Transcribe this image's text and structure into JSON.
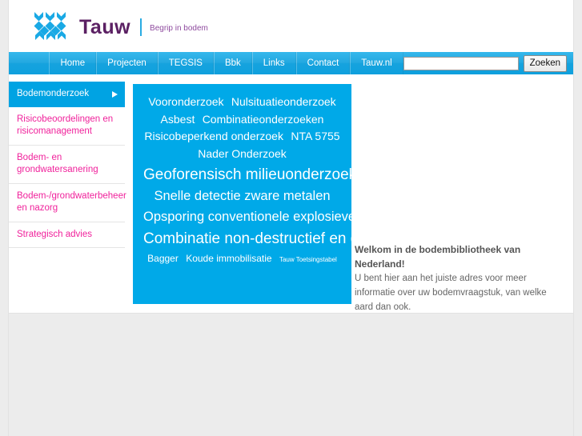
{
  "header": {
    "logo_icon": "tauw-lattice-logo",
    "brand": "Tauw",
    "tagline": "Begrip in bodem"
  },
  "nav": {
    "items": [
      {
        "label": "Home"
      },
      {
        "label": "Projecten"
      },
      {
        "label": "TEGSIS"
      },
      {
        "label": "Bbk"
      },
      {
        "label": "Links"
      },
      {
        "label": "Contact"
      },
      {
        "label": "Tauw.nl"
      }
    ],
    "search": {
      "value": "",
      "placeholder": "",
      "button_label": "Zoeken"
    }
  },
  "sidebar": {
    "items": [
      {
        "label": "Bodemonderzoek",
        "active": true
      },
      {
        "label": "Risicobeoordelingen en risicomanagement",
        "active": false
      },
      {
        "label": "Bodem- en grondwatersanering",
        "active": false
      },
      {
        "label": "Bodem-/grondwaterbeheer en nazorg",
        "active": false
      },
      {
        "label": "Strategisch advies",
        "active": false
      }
    ]
  },
  "tagcloud": {
    "tags": [
      {
        "label": "Vooronderzoek",
        "size": "md"
      },
      {
        "label": "Nulsituatieonderzoek",
        "size": "md"
      },
      {
        "label": "Asbest",
        "size": "md"
      },
      {
        "label": "Combinatieonderzoeken",
        "size": "md"
      },
      {
        "label": "Risicobeperkend onderzoek",
        "size": "md"
      },
      {
        "label": "NTA 5755",
        "size": "md"
      },
      {
        "label": "Nader Onderzoek",
        "size": "md"
      },
      {
        "label": "Geoforensisch milieuonderzoek",
        "size": "xl"
      },
      {
        "label": "Snelle detectie zware metalen",
        "size": "lg"
      },
      {
        "label": "Opsporing conventionele explosieven",
        "size": "lg"
      },
      {
        "label": "Combinatie non-destructief en destructief onderzoek",
        "size": "xl"
      },
      {
        "label": "Bagger",
        "size": "sm"
      },
      {
        "label": "Koude immobilisatie",
        "size": "sm"
      },
      {
        "label": "Tauw Toetsingstabel",
        "size": "xxs"
      }
    ]
  },
  "welcome": {
    "title": "Welkom in de bodembibliotheek van Nederland!",
    "body": "U bent hier aan het juiste adres voor meer informatie over uw bodemvraagstuk, van welke aard dan ook."
  },
  "colors": {
    "brand_blue": "#00a9e8",
    "nav_blue": "#16a3de",
    "link_pink": "#f0219b",
    "brand_purple": "#5b2063",
    "page_bg": "#ececec"
  }
}
